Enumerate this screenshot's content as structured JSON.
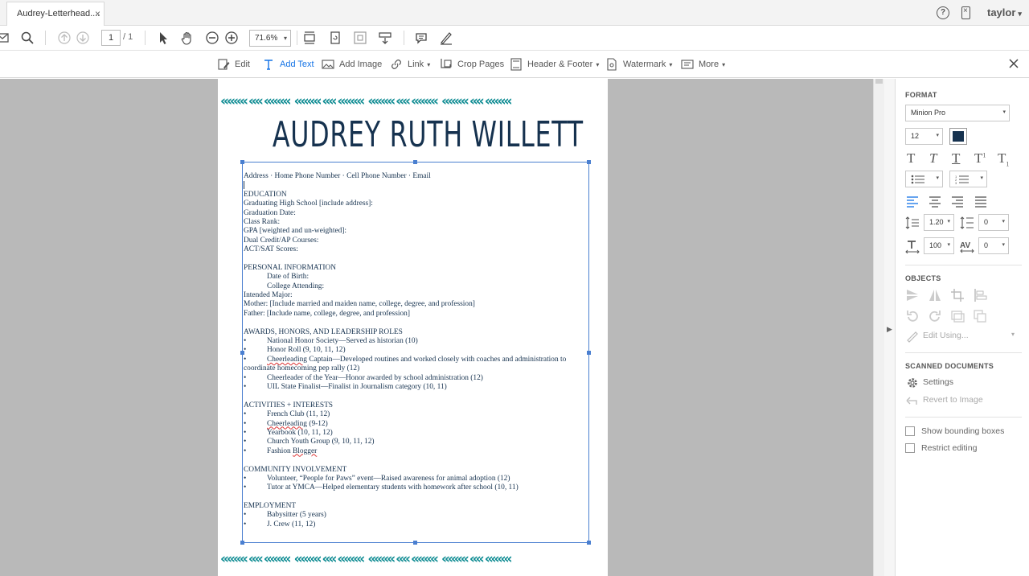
{
  "tab": {
    "title": "Audrey-Letterhead....",
    "close": "×"
  },
  "header": {
    "help": "?",
    "user": "taylor",
    "user_caret": "▾"
  },
  "toolbar": {
    "page_current": "1",
    "page_total": "/ 1",
    "zoom": "71.6%",
    "caret": "▾"
  },
  "edit_toolbar": {
    "items": [
      {
        "label": "Edit"
      },
      {
        "label": "Add Text"
      },
      {
        "label": "Add Image"
      },
      {
        "label": "Link"
      },
      {
        "label": "Crop Pages"
      },
      {
        "label": "Header & Footer"
      },
      {
        "label": "Watermark"
      },
      {
        "label": "More"
      }
    ],
    "caret": "▾",
    "accent": "#1473e6"
  },
  "document": {
    "title": "AUDREY RUTH WILLETT",
    "border_pattern": "«««« «« ««««",
    "lines": {
      "contact": "Address · Home Phone Number · Cell Phone Number · Email",
      "education": "EDUCATION",
      "edu_school": "Graduating High School [include address]:",
      "edu_grad_date": "Graduation Date:",
      "edu_rank": "Class Rank:",
      "edu_gpa": "GPA [weighted and un-weighted]:",
      "edu_dual": "Dual Credit/AP Courses:",
      "edu_act": "ACT/SAT Scores:",
      "personal": "PERSONAL INFORMATION",
      "per_dob": "Date of Birth:",
      "per_college": "College Attending:",
      "per_major": "Intended Major:",
      "per_mother": "Mother: [Include married and maiden name, college, degree, and profession]",
      "per_father": "Father: [Include name, college, degree, and profession]",
      "awards": "AWARDS, HONORS, AND LEADERSHIP ROLES",
      "aw_nhs": "National Honor Society—Served as historian (10)",
      "aw_honor": "Honor Roll (9, 10, 11, 12)",
      "aw_cheer_a": "Cheerleading",
      "aw_cheer_b": " Captain—Developed routines and worked closely with coaches and administration to",
      "aw_cheer_c": "coordinate homecoming pep rally (12)",
      "aw_coy": "Cheerleader of the Year—Honor awarded by school administration (12)",
      "aw_uil": "UIL State Finalist—Finalist in Journalism category (10, 11)",
      "activities": "ACTIVITIES + INTERESTS",
      "ac_french": "French Club (11, 12)",
      "ac_cheer_a": "Cheerleading",
      "ac_cheer_b": " (9-12)",
      "ac_yearbook": "Yearbook (10, 11, 12)",
      "ac_church": "Church Youth Group (9, 10, 11, 12)",
      "ac_fashion_a": "Fashion ",
      "ac_fashion_b": "Blogger",
      "community": "COMMUNITY INVOLVEMENT",
      "co_vol": "Volunteer, “People for Paws” event—Raised awareness for animal adoption (12)",
      "co_tutor": "Tutor at YMCA—Helped elementary students with homework after school (10, 11)",
      "employment": "EMPLOYMENT",
      "em_baby": "Babysitter (5 years)",
      "em_crew": "J. Crew (11, 12)"
    },
    "text_color": "#16324f",
    "accent_teal": "#0f8c93"
  },
  "format_panel": {
    "title": "FORMAT",
    "font": "Minion Pro",
    "size": "12",
    "color": "#16324f",
    "line_spacing": "1.20",
    "para_spacing": "0",
    "h_scale": "100",
    "char_spacing": "0",
    "caret": "▾"
  },
  "objects_panel": {
    "title": "OBJECTS",
    "edit_using": "Edit Using..."
  },
  "scanned_panel": {
    "title": "SCANNED DOCUMENTS",
    "settings": "Settings",
    "revert": "Revert to Image"
  },
  "options": {
    "show_bounding": "Show bounding boxes",
    "restrict": "Restrict editing"
  }
}
